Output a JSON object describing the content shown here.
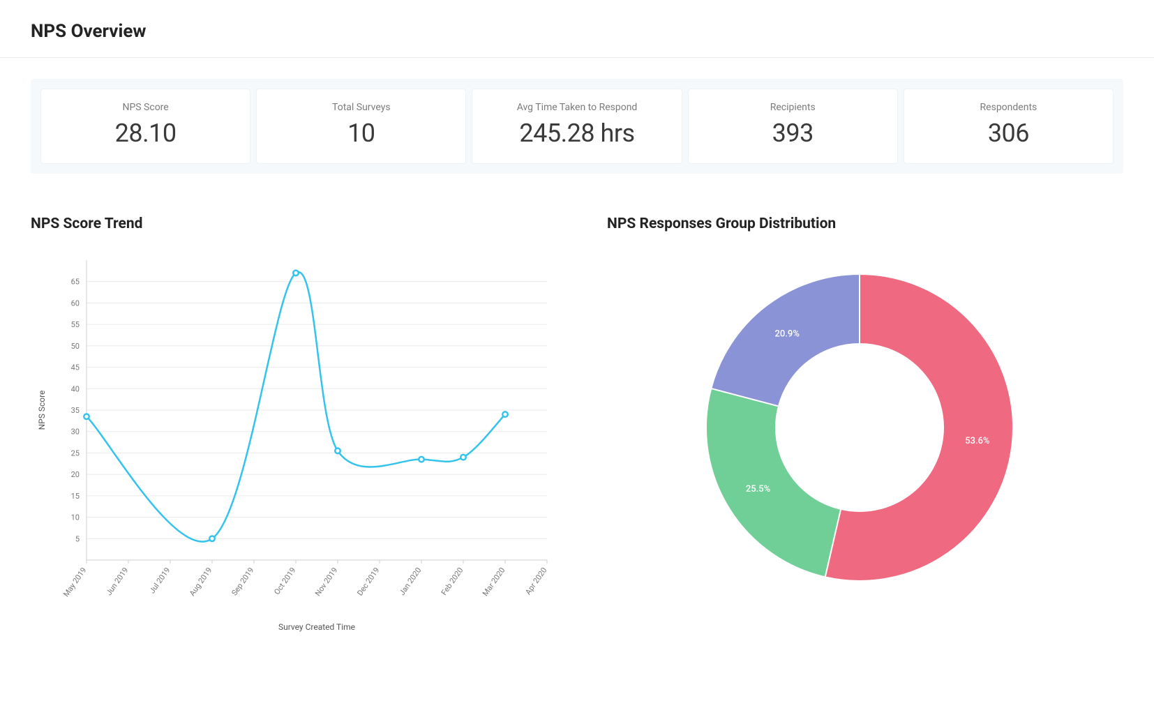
{
  "header": {
    "title": "NPS Overview"
  },
  "summary": [
    {
      "label": "NPS Score",
      "value": "28.10"
    },
    {
      "label": "Total Surveys",
      "value": "10"
    },
    {
      "label": "Avg Time Taken to Respond",
      "value": "245.28 hrs"
    },
    {
      "label": "Recipients",
      "value": "393"
    },
    {
      "label": "Respondents",
      "value": "306"
    }
  ],
  "chart_data": [
    {
      "type": "line",
      "title": "NPS Score Trend",
      "xlabel": "Survey Created Time",
      "ylabel": "NPS Score",
      "ylim": [
        0,
        70
      ],
      "y_ticks": [
        5,
        10,
        15,
        20,
        25,
        30,
        35,
        40,
        45,
        50,
        55,
        60,
        65
      ],
      "categories": [
        "May 2019",
        "Jun 2019",
        "Jul 2019",
        "Aug 2019",
        "Sep 2019",
        "Oct 2019",
        "Nov 2019",
        "Dec 2019",
        "Jan 2020",
        "Feb 2020",
        "Mar 2020",
        "Apr 2020"
      ],
      "series": [
        {
          "name": "NPS Score",
          "color": "#34c3eb",
          "points": [
            {
              "x": "May 2019",
              "y": 33.5
            },
            {
              "x": "Aug 2019",
              "y": 5
            },
            {
              "x": "Oct 2019",
              "y": 67
            },
            {
              "x": "Nov 2019",
              "y": 25.5
            },
            {
              "x": "Jan 2020",
              "y": 23.5
            },
            {
              "x": "Feb 2020",
              "y": 24
            },
            {
              "x": "Mar 2020",
              "y": 34
            }
          ]
        }
      ]
    },
    {
      "type": "pie",
      "title": "NPS Responses Group Distribution",
      "slices": [
        {
          "label": "53.6%",
          "value": 53.6,
          "color": "#ef6a81"
        },
        {
          "label": "25.5%",
          "value": 25.5,
          "color": "#6fcf97"
        },
        {
          "label": "20.9%",
          "value": 20.9,
          "color": "#8a93d6"
        }
      ]
    }
  ]
}
